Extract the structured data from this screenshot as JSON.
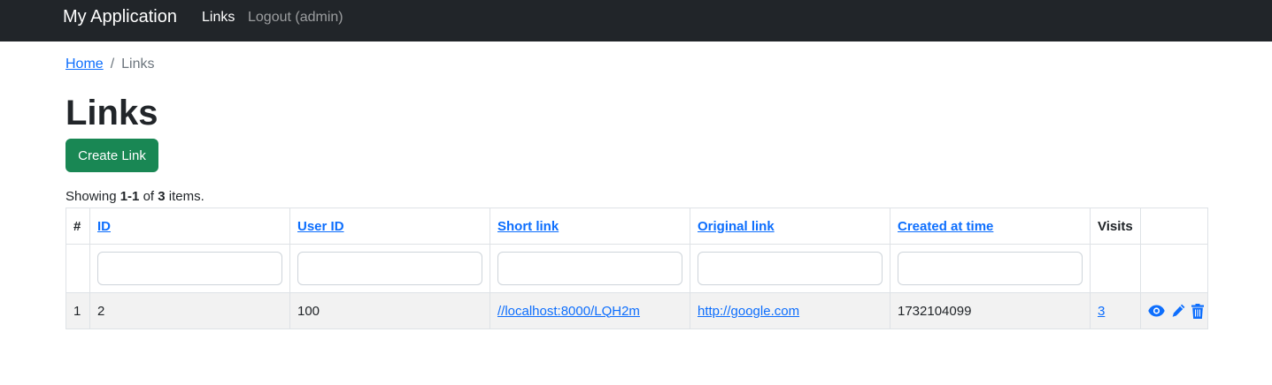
{
  "navbar": {
    "brand": "My Application",
    "links": [
      {
        "label": "Links"
      },
      {
        "label": "Logout (admin)"
      }
    ]
  },
  "breadcrumb": {
    "home": "Home",
    "separator": "/",
    "current": "Links"
  },
  "page": {
    "title": "Links",
    "create_button": "Create Link"
  },
  "summary": {
    "prefix": "Showing ",
    "range": "1-1",
    "middle": " of ",
    "total": "3",
    "suffix": " items."
  },
  "table": {
    "headers": [
      "#",
      "ID",
      "User ID",
      "Short link",
      "Original link",
      "Created at time",
      "Visits"
    ],
    "rows": [
      {
        "index": "1",
        "id": "2",
        "user_id": "100",
        "short_link": "//localhost:8000/LQH2m",
        "original_link": "http://google.com",
        "created_at": "1732104099",
        "visits": "3"
      }
    ]
  },
  "icons": {
    "view": "eye-icon",
    "update": "pencil-icon",
    "delete": "trash-icon"
  },
  "colors": {
    "navbar_bg": "#212529",
    "link": "#0d6efd",
    "create_button": "#198754",
    "row_stripe": "#f2f2f2"
  }
}
